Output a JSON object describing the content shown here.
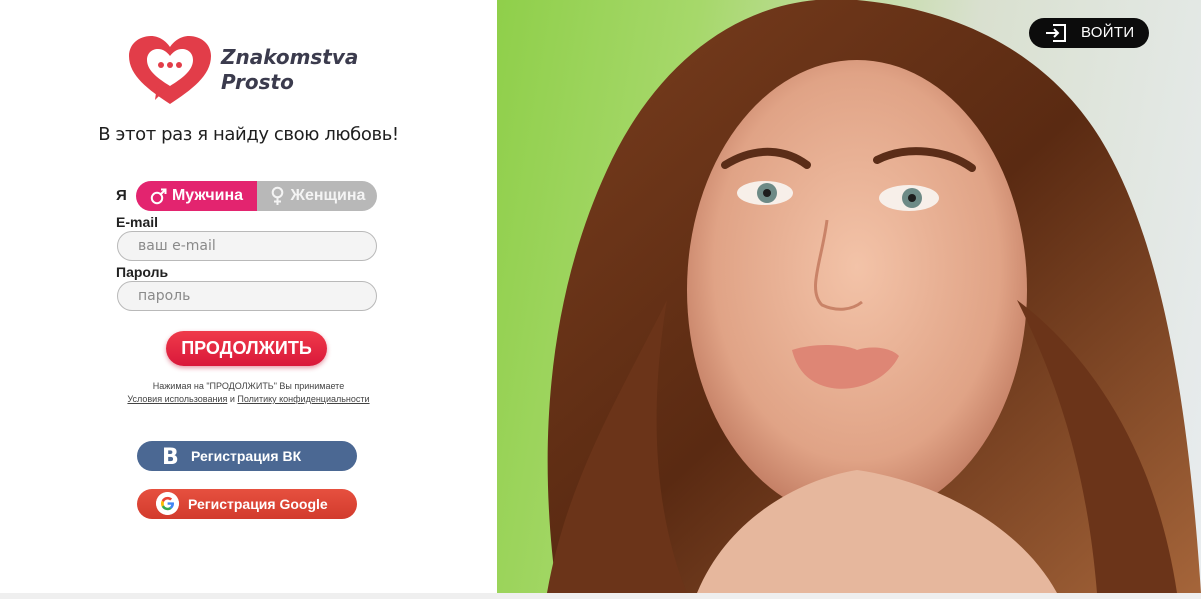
{
  "brand": {
    "line1": "Znakomstva",
    "line2": "Prosto",
    "heart_color": "#e23d49"
  },
  "tagline": "В этот раз я найду свою любовь!",
  "gender": {
    "prefix": "Я",
    "male": "Мужчина",
    "female": "Женщина",
    "selected": "male"
  },
  "email": {
    "label": "E-mail",
    "placeholder": "ваш e-mail",
    "value": ""
  },
  "password": {
    "label": "Пароль",
    "placeholder": "пароль",
    "value": ""
  },
  "continue_label": "ПРОДОЛЖИТЬ",
  "terms": {
    "prefix": "Нажимая на \"ПРОДОЛЖИТЬ\" Вы принимаете",
    "terms_link": "Условия использования",
    "and": "и",
    "privacy_link": "Политику конфиденциальности"
  },
  "social": {
    "vk_glyph": "В",
    "vk_label": "Регистрация ВК",
    "google_label": "Регистрация Google"
  },
  "login_label": "ВОЙТИ",
  "icons": {
    "male": "male-symbol-icon",
    "female": "female-symbol-icon",
    "login": "sign-in-icon",
    "google": "google-icon",
    "vk": "vk-icon"
  },
  "colors": {
    "accent_pink": "#e3246f",
    "accent_red": "#e02c43",
    "vk_blue": "#4b6893",
    "google_red": "#dc4535"
  }
}
